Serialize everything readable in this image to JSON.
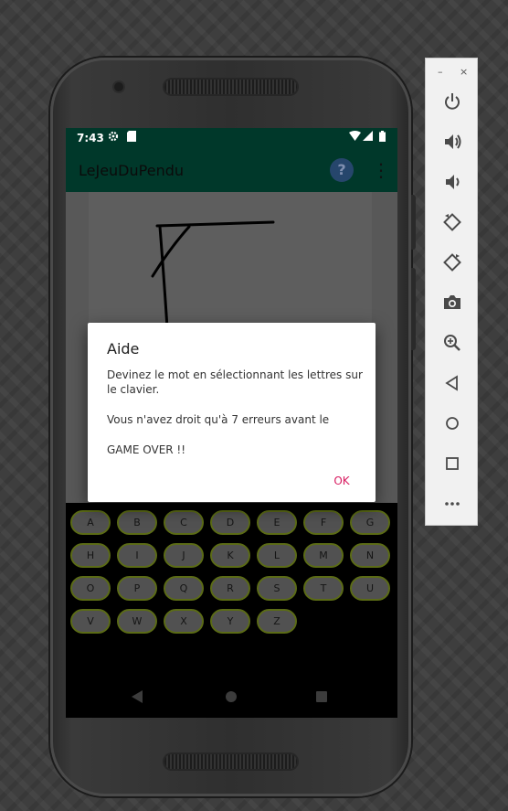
{
  "status_bar": {
    "time": "7:43",
    "icons": [
      "gear-icon",
      "sd-card-icon",
      "wifi-icon",
      "signal-icon",
      "battery-icon"
    ]
  },
  "app_bar": {
    "title": "LeJeuDuPendu",
    "help_label": "?",
    "overflow_label": "⋮"
  },
  "dialog": {
    "title": "Aide",
    "message_lines": [
      "Devinez le mot en sélectionnant les lettres sur le clavier.",
      "Vous n'avez droit qu'à 7 erreurs avant le",
      "GAME OVER !!"
    ],
    "ok_label": "OK",
    "accent_color": "#d81b60"
  },
  "keyboard": {
    "rows": [
      [
        "A",
        "B",
        "C",
        "D",
        "E",
        "F",
        "G"
      ],
      [
        "H",
        "I",
        "J",
        "K",
        "L",
        "M",
        "N"
      ],
      [
        "O",
        "P",
        "Q",
        "R",
        "S",
        "T",
        "U"
      ],
      [
        "V",
        "W",
        "X",
        "Y",
        "Z"
      ]
    ]
  },
  "navigation": [
    "back-icon",
    "home-icon",
    "recents-icon"
  ],
  "emulator_toolbar": {
    "minimize": "–",
    "close": "×",
    "tools": [
      "power-icon",
      "volume-up-icon",
      "volume-down-icon",
      "rotate-left-icon",
      "rotate-right-icon",
      "camera-icon",
      "zoom-icon",
      "back-icon",
      "home-icon",
      "overview-icon",
      "more-icon"
    ]
  },
  "colors": {
    "app_bar": "#00382a",
    "key_border": "#5b6b16",
    "dialog_button": "#d81b60"
  }
}
